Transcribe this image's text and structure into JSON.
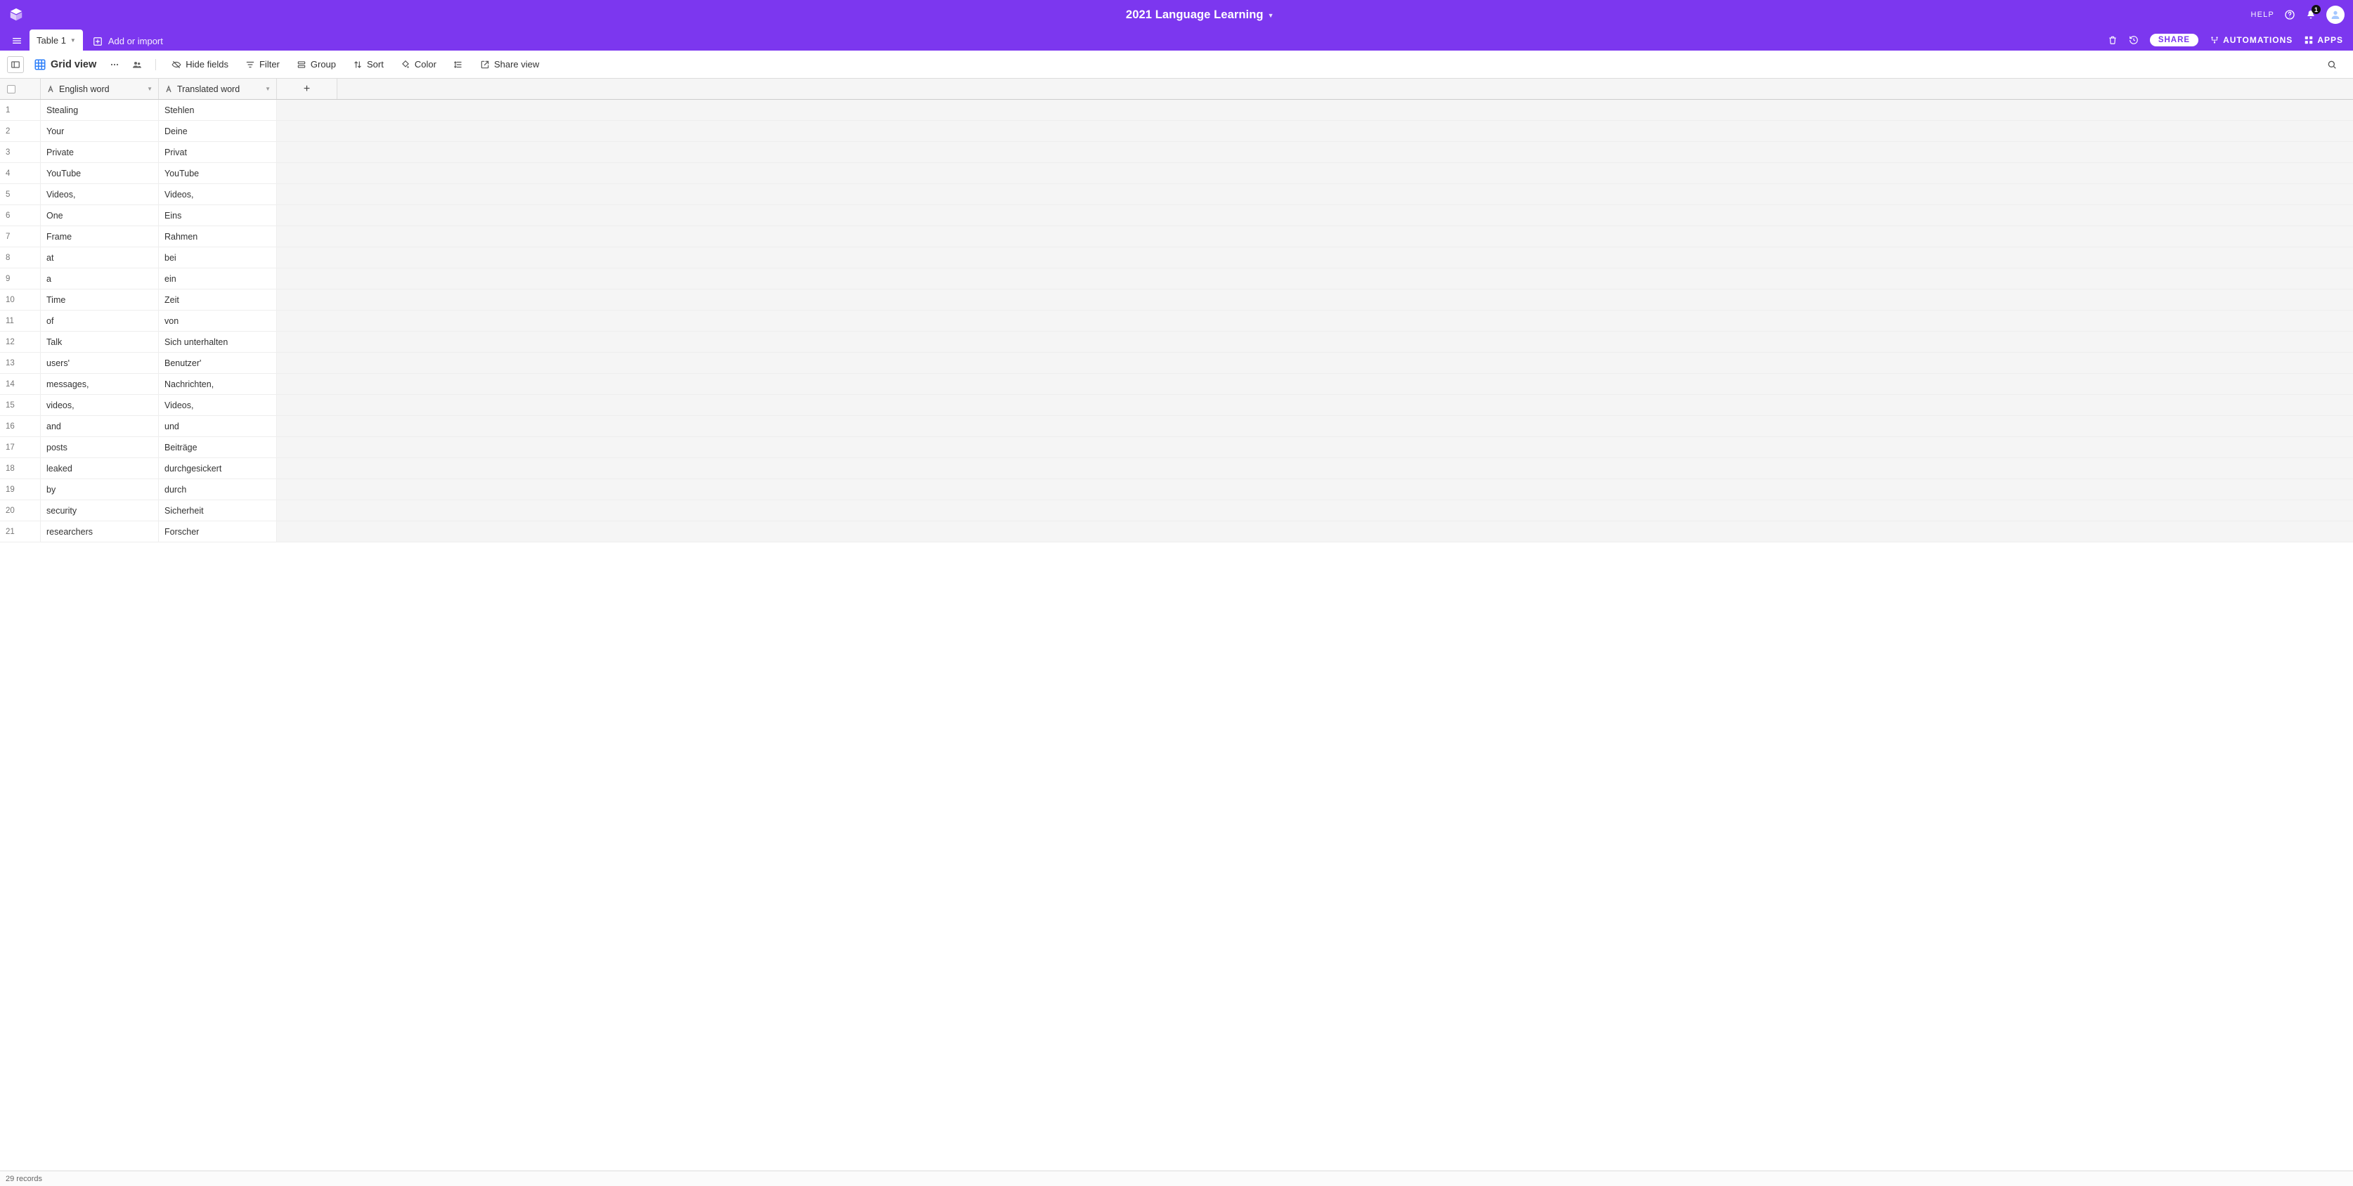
{
  "topbar": {
    "title": "2021 Language Learning",
    "help_label": "HELP",
    "notif_count": "1"
  },
  "tabs": {
    "active": "Table 1",
    "add_label": "Add or import"
  },
  "right_actions": {
    "share": "SHARE",
    "automations": "AUTOMATIONS",
    "apps": "APPS"
  },
  "viewbar": {
    "view_name": "Grid view",
    "hide_fields": "Hide fields",
    "filter": "Filter",
    "group": "Group",
    "sort": "Sort",
    "color": "Color",
    "share_view": "Share view"
  },
  "columns": {
    "col1": "English word",
    "col2": "Translated word"
  },
  "rows": [
    {
      "n": "1",
      "a": "Stealing",
      "b": "Stehlen"
    },
    {
      "n": "2",
      "a": "Your",
      "b": "Deine"
    },
    {
      "n": "3",
      "a": "Private",
      "b": "Privat"
    },
    {
      "n": "4",
      "a": "YouTube",
      "b": "YouTube"
    },
    {
      "n": "5",
      "a": "Videos,",
      "b": "Videos,"
    },
    {
      "n": "6",
      "a": "One",
      "b": "Eins"
    },
    {
      "n": "7",
      "a": "Frame",
      "b": "Rahmen"
    },
    {
      "n": "8",
      "a": "at",
      "b": "bei"
    },
    {
      "n": "9",
      "a": "a",
      "b": "ein"
    },
    {
      "n": "10",
      "a": "Time",
      "b": "Zeit"
    },
    {
      "n": "11",
      "a": "of",
      "b": "von"
    },
    {
      "n": "12",
      "a": "Talk",
      "b": "Sich unterhalten"
    },
    {
      "n": "13",
      "a": "users'",
      "b": "Benutzer'"
    },
    {
      "n": "14",
      "a": "messages,",
      "b": "Nachrichten,"
    },
    {
      "n": "15",
      "a": "videos,",
      "b": "Videos,"
    },
    {
      "n": "16",
      "a": "and",
      "b": "und"
    },
    {
      "n": "17",
      "a": "posts",
      "b": "Beiträge"
    },
    {
      "n": "18",
      "a": "leaked",
      "b": "durchgesickert"
    },
    {
      "n": "19",
      "a": "by",
      "b": "durch"
    },
    {
      "n": "20",
      "a": "security",
      "b": "Sicherheit"
    },
    {
      "n": "21",
      "a": "researchers",
      "b": "Forscher"
    }
  ],
  "footer": {
    "record_count": "29 records"
  }
}
